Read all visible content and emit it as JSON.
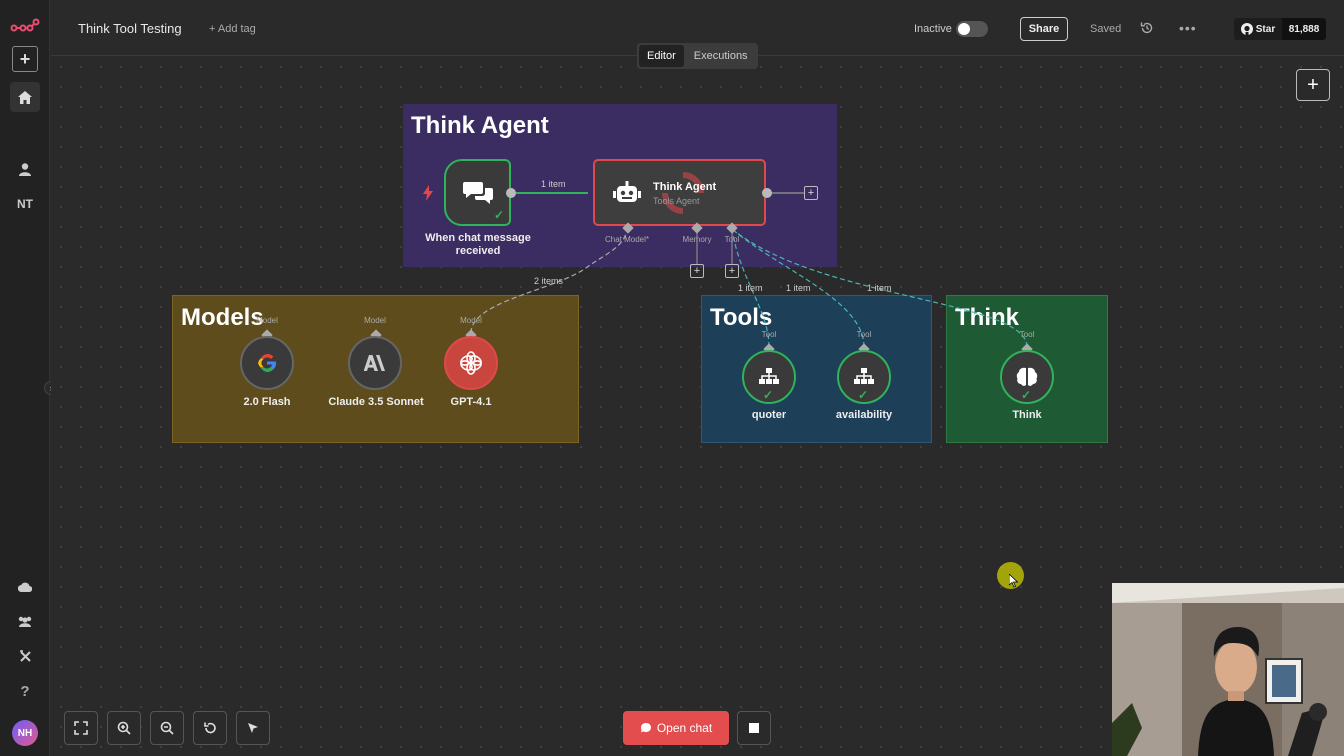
{
  "app": {
    "workflow_title": "Think Tool Testing",
    "add_tag_label": "+ Add tag"
  },
  "header": {
    "inactive_label": "Inactive",
    "share_label": "Share",
    "saved_label": "Saved",
    "github_star_label": "Star",
    "github_star_count": "81,888",
    "workflow_active": false
  },
  "sidebar": {
    "nt_label": "NT",
    "avatar_initials": "NH",
    "help_label": "?"
  },
  "tabs": [
    {
      "label": "Editor",
      "active": true
    },
    {
      "label": "Executions",
      "active": false
    }
  ],
  "groups": {
    "think_agent": {
      "title": "Think Agent",
      "color": "#3b2d62"
    },
    "models": {
      "title": "Models",
      "color": "#5e4c1d"
    },
    "tools": {
      "title": "Tools",
      "color": "#1e3f58"
    },
    "think": {
      "title": "Think",
      "color": "#1e5a34"
    }
  },
  "nodes": {
    "trigger": {
      "label": "When chat message received",
      "icon": "chat-bubbles-icon",
      "status": "success"
    },
    "agent": {
      "title": "Think Agent",
      "subtitle": "Tools Agent",
      "icon": "robot-icon",
      "status": "running"
    },
    "agent_ports": {
      "chat_model": "Chat Model*",
      "memory": "Memory",
      "tool": "Tool"
    },
    "models": [
      {
        "label": "2.0 Flash",
        "port": "Model",
        "icon": "google-icon"
      },
      {
        "label": "Claude 3.5 Sonnet",
        "port": "Model",
        "icon": "anthropic-icon"
      },
      {
        "label": "GPT-4.1",
        "port": "Model",
        "icon": "openai-icon",
        "status": "running"
      }
    ],
    "tools": [
      {
        "label": "quoter",
        "port": "Tool",
        "icon": "sitemap-icon",
        "status": "success"
      },
      {
        "label": "availability",
        "port": "Tool",
        "icon": "sitemap-icon",
        "status": "success"
      }
    ],
    "think": {
      "label": "Think",
      "port": "Tool",
      "icon": "brain-icon",
      "status": "success"
    }
  },
  "connections": {
    "trigger_to_agent": "1 item",
    "model_to_agent": "2 items",
    "tool_quoter": "1 item",
    "tool_availability": "1 item",
    "tool_think": "1 item"
  },
  "footer": {
    "open_chat_label": "Open chat"
  },
  "colors": {
    "accent": "#e44d4d",
    "success": "#2fb35b",
    "canvas": "#2a2a2a"
  }
}
